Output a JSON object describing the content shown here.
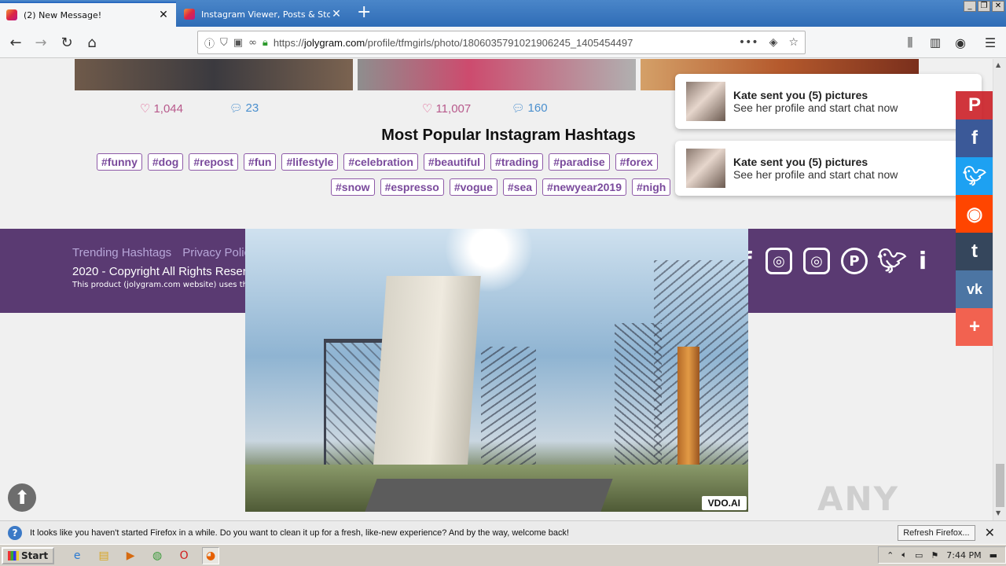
{
  "browser": {
    "tabs": [
      {
        "label": "(2) New Message!",
        "active": true
      },
      {
        "label": "Instagram Viewer, Posts & Story V",
        "active": false
      }
    ],
    "url_prefix": "https://",
    "url_domain": "jolygram.com",
    "url_path": "/profile/tfmgirls/photo/1806035791021906245_1405454497"
  },
  "posts": [
    {
      "likes": "1,044",
      "comments": "23"
    },
    {
      "likes": "11,007",
      "comments": "160"
    }
  ],
  "hashtags_section": {
    "title": "Most Popular Instagram Hashtags",
    "row1": [
      "#funny",
      "#dog",
      "#repost",
      "#fun",
      "#lifestyle",
      "#celebration",
      "#beautiful",
      "#trading",
      "#paradise",
      "#forex"
    ],
    "row2": [
      "#snow",
      "#espresso",
      "#vogue",
      "#sea",
      "#newyear2019",
      "#nigh"
    ]
  },
  "footer": {
    "links": [
      "Trending Hashtags",
      "Privacy Polic"
    ],
    "copyright": "2020 - Copyright All Rights Reserv",
    "disclaimer": "This product (jolygram.com website) uses the"
  },
  "video": {
    "badge": "VDO.AI"
  },
  "notifications": [
    {
      "title": "Kate sent you (5) pictures",
      "subtitle": "See her profile and start chat now"
    },
    {
      "title": "Kate sent you (5) pictures",
      "subtitle": "See her profile and start chat now"
    }
  ],
  "share_bar": [
    {
      "icon": "pinterest-icon",
      "glyph": "P",
      "color": "#cb2027"
    },
    {
      "icon": "facebook-icon",
      "glyph": "f",
      "color": "#3b5998"
    },
    {
      "icon": "twitter-icon",
      "glyph": "t",
      "color": "#1da1f2"
    },
    {
      "icon": "reddit-icon",
      "glyph": "r",
      "color": "#ff4500"
    },
    {
      "icon": "tumblr-icon",
      "glyph": "t",
      "color": "#35465c"
    },
    {
      "icon": "vk-icon",
      "glyph": "vk",
      "color": "#4c75a3"
    },
    {
      "icon": "more-icon",
      "glyph": "+",
      "color": "#f26250"
    }
  ],
  "infobar": {
    "message": "It looks like you haven't started Firefox in a while. Do you want to clean it up for a fresh, like-new experience? And by the way, welcome back!",
    "button": "Refresh Firefox..."
  },
  "taskbar": {
    "start": "Start",
    "clock": "7:44 PM"
  },
  "watermark": "ANY RUN"
}
